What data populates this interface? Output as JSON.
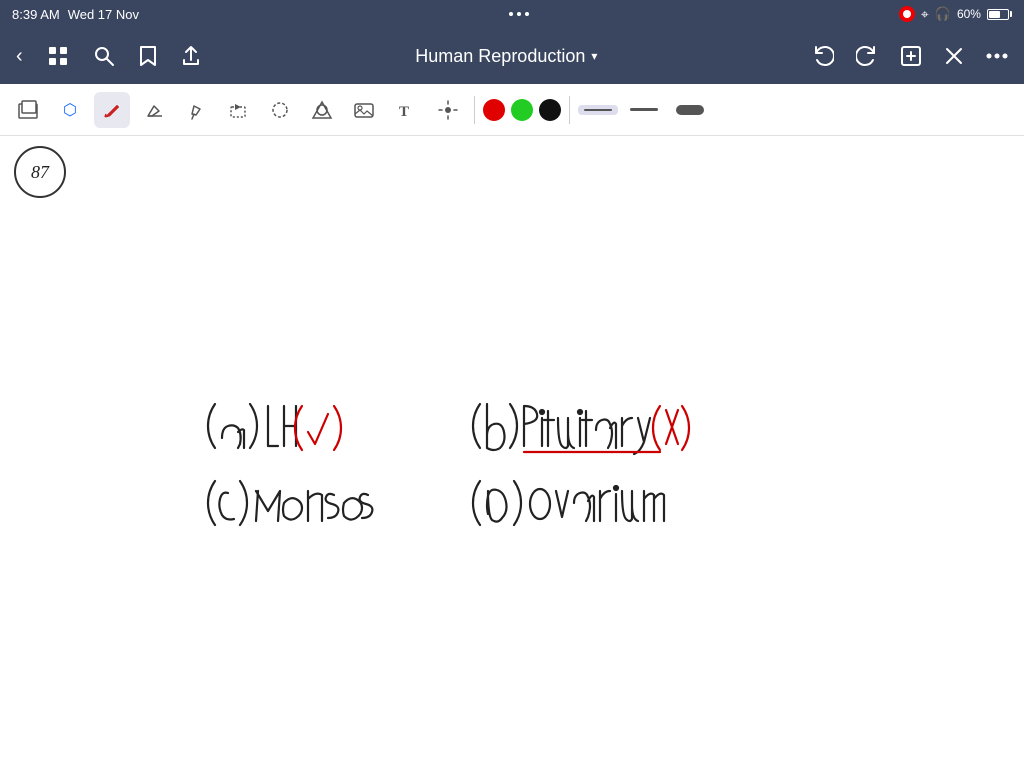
{
  "status_bar": {
    "time": "8:39 AM",
    "date": "Wed 17 Nov",
    "battery_percent": "60%"
  },
  "title_bar": {
    "title": "Human Reproduction",
    "dropdown_arrow": "▾"
  },
  "toolbar": {
    "tools": [
      {
        "name": "layers",
        "icon": "⊞",
        "active": false
      },
      {
        "name": "bluetooth",
        "icon": "✱",
        "active": false
      },
      {
        "name": "pen",
        "icon": "✏",
        "active": true
      },
      {
        "name": "eraser",
        "icon": "⬡",
        "active": false
      },
      {
        "name": "highlighter",
        "icon": "◇",
        "active": false
      },
      {
        "name": "selection",
        "icon": "▭",
        "active": false
      },
      {
        "name": "lasso",
        "icon": "⊙",
        "active": false
      },
      {
        "name": "shapes",
        "icon": "☆",
        "active": false
      },
      {
        "name": "image",
        "icon": "⬜",
        "active": false
      },
      {
        "name": "text",
        "icon": "T",
        "active": false
      },
      {
        "name": "spotlight",
        "icon": "✳",
        "active": false
      }
    ],
    "colors": [
      {
        "name": "red",
        "hex": "#e00000"
      },
      {
        "name": "green",
        "hex": "#22cc22"
      },
      {
        "name": "black",
        "hex": "#111111"
      }
    ],
    "strokes": [
      "thin",
      "medium",
      "thick"
    ],
    "active_stroke": "thin"
  },
  "canvas": {
    "page_number": "87",
    "content_description": "Handwritten multiple choice answers: (a) LH with checkmark in red, (b) Pituitary with X in red, (c) Menses, (d) Ovarium"
  },
  "nav": {
    "back": "‹",
    "undo": "↩",
    "redo": "↪",
    "add": "+",
    "close": "✕",
    "more": "•••"
  }
}
